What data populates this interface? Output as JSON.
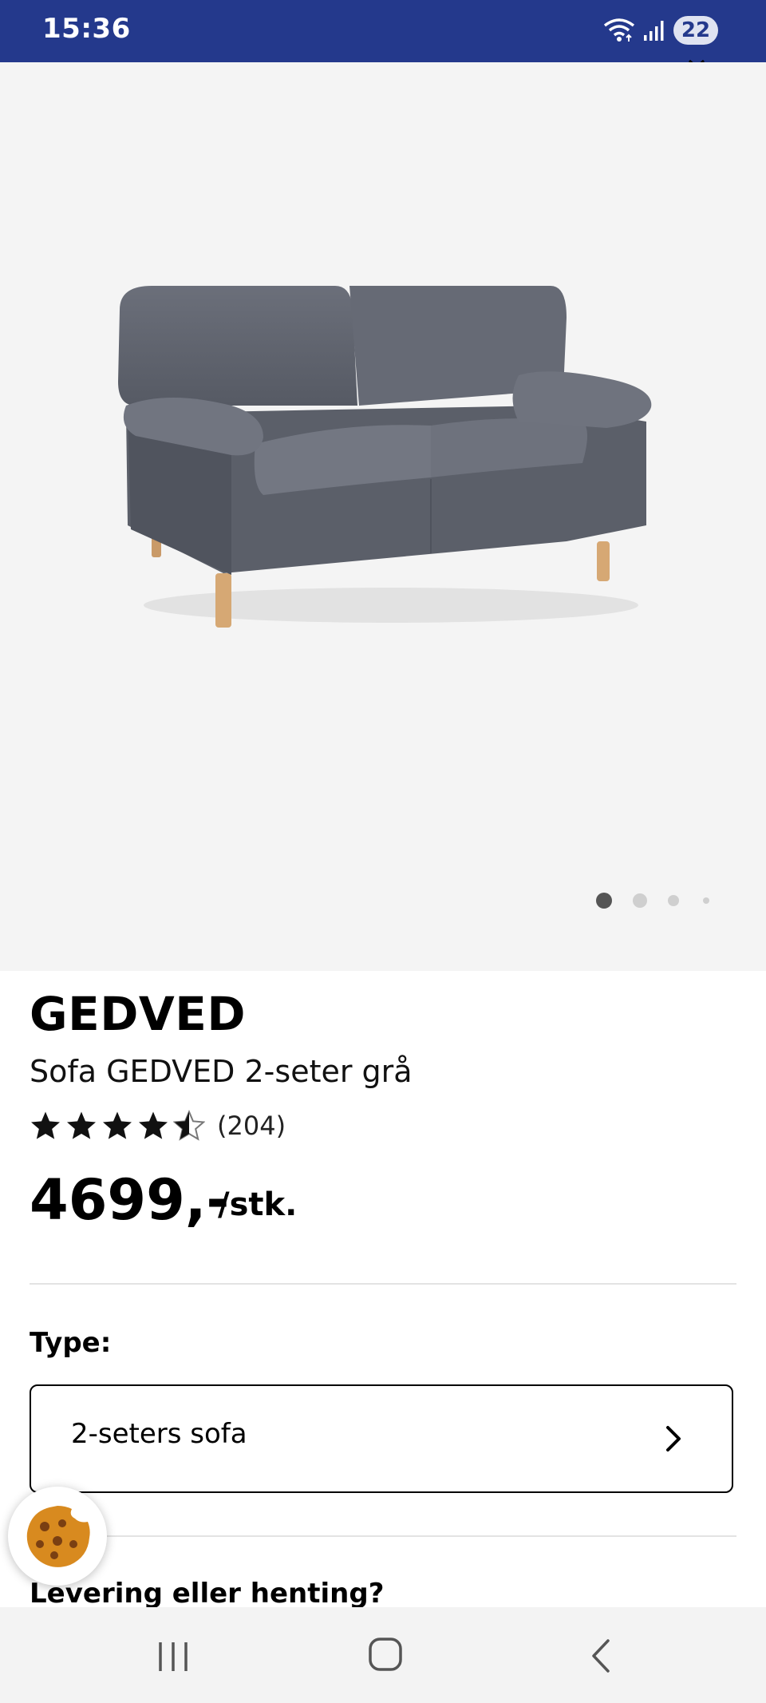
{
  "status_bar": {
    "time": "15:36",
    "battery": "22",
    "background_color": "#24398c",
    "icons": [
      "wifi-icon",
      "signal-icon",
      "battery-icon"
    ]
  },
  "gallery": {
    "image": "gray-two-seater-sofa",
    "total_images": 4,
    "current_index": 1
  },
  "product": {
    "brand": "GEDVED",
    "name": "Sofa GEDVED 2-seter grå",
    "rating_value": 4.5,
    "rating_max": 5,
    "review_count": "(204)",
    "price": "4699,-",
    "unit": "/stk."
  },
  "type_selector": {
    "label": "Type:",
    "value": "2-seters sofa"
  },
  "delivery": {
    "heading": "Levering eller henting?"
  },
  "cookie_button": {
    "icon": "cookie-icon"
  },
  "nav_bar": {
    "buttons": [
      "recent-apps-button",
      "home-button",
      "back-button"
    ]
  }
}
